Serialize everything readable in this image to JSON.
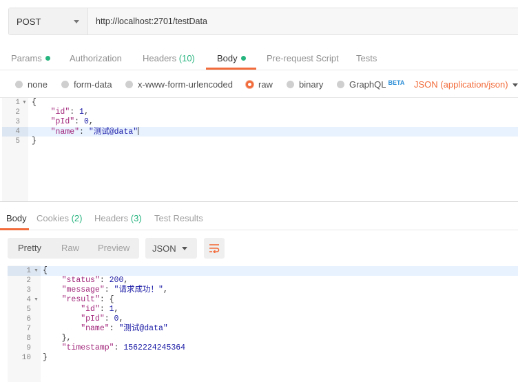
{
  "request": {
    "method": "POST",
    "url": "http://localhost:2701/testData"
  },
  "req_tabs": {
    "params": "Params",
    "authorization": "Authorization",
    "headers": "Headers",
    "headers_count": "(10)",
    "body": "Body",
    "prerequest": "Pre-request Script",
    "tests": "Tests"
  },
  "body_types": {
    "none": "none",
    "form_data": "form-data",
    "urlencoded": "x-www-form-urlencoded",
    "raw": "raw",
    "binary": "binary",
    "graphql": "GraphQL",
    "beta": "BETA",
    "content_type": "JSON (application/json)"
  },
  "request_body": {
    "line_numbers": [
      "1",
      "2",
      "3",
      "4",
      "5"
    ],
    "lines": [
      "{",
      "    \"id\": 1,",
      "    \"pId\": 0,",
      "    \"name\": \"测试@data\"",
      "}"
    ]
  },
  "resp_tabs": {
    "body": "Body",
    "cookies": "Cookies",
    "cookies_count": "(2)",
    "headers": "Headers",
    "headers_count": "(3)",
    "test_results": "Test Results"
  },
  "resp_toolbar": {
    "pretty": "Pretty",
    "raw": "Raw",
    "preview": "Preview",
    "format": "JSON"
  },
  "response_body": {
    "line_numbers": [
      "1",
      "2",
      "3",
      "4",
      "5",
      "6",
      "7",
      "8",
      "9",
      "10"
    ],
    "lines": [
      "{",
      "    \"status\": 200,",
      "    \"message\": \"请求成功！\",",
      "    \"result\": {",
      "        \"id\": 1,",
      "        \"pId\": 0,",
      "        \"name\": \"测试@data\"",
      "    },",
      "    \"timestamp\": 1562224245364",
      "}"
    ]
  },
  "colors": {
    "accent": "#f26b3a",
    "count_green": "#26b47f",
    "beta_blue": "#2d8fd6"
  }
}
